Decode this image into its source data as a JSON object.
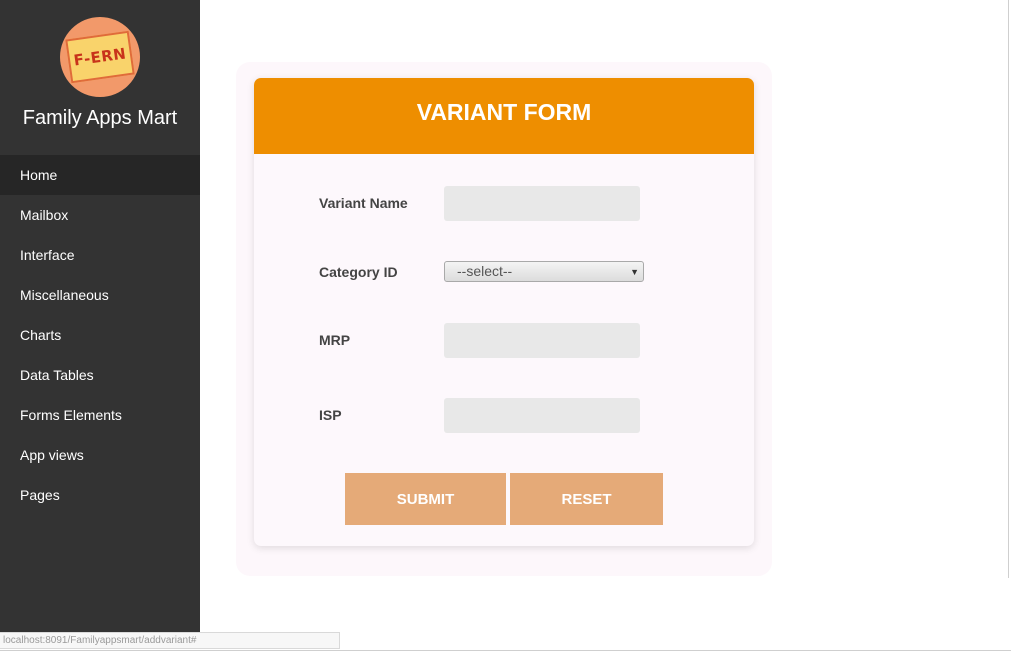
{
  "sidebar": {
    "logo_text": "F-ERN",
    "brand": "Family Apps Mart",
    "items": [
      {
        "label": "Home",
        "active": true
      },
      {
        "label": "Mailbox"
      },
      {
        "label": "Interface"
      },
      {
        "label": "Miscellaneous"
      },
      {
        "label": "Charts"
      },
      {
        "label": "Data Tables"
      },
      {
        "label": "Forms Elements"
      },
      {
        "label": "App views"
      },
      {
        "label": "Pages"
      }
    ]
  },
  "form": {
    "title": "VARIANT FORM",
    "variant_name_label": "Variant Name",
    "variant_name_value": "",
    "category_label": "Category ID",
    "category_selected": "--select--",
    "mrp_label": "MRP",
    "mrp_value": "",
    "isp_label": "ISP",
    "isp_value": "",
    "submit_label": "SUBMIT",
    "reset_label": "RESET"
  },
  "statusbar": {
    "url": "localhost:8091/Familyappsmart/addvariant#"
  },
  "colors": {
    "sidebar_bg": "#333333",
    "header_accent": "#ee8e00",
    "button_bg": "#e5aa78",
    "logo_bg": "#f2996a"
  },
  "icons": {
    "logo": "fern-logo-icon",
    "select_arrow": "chevron-down-icon"
  }
}
